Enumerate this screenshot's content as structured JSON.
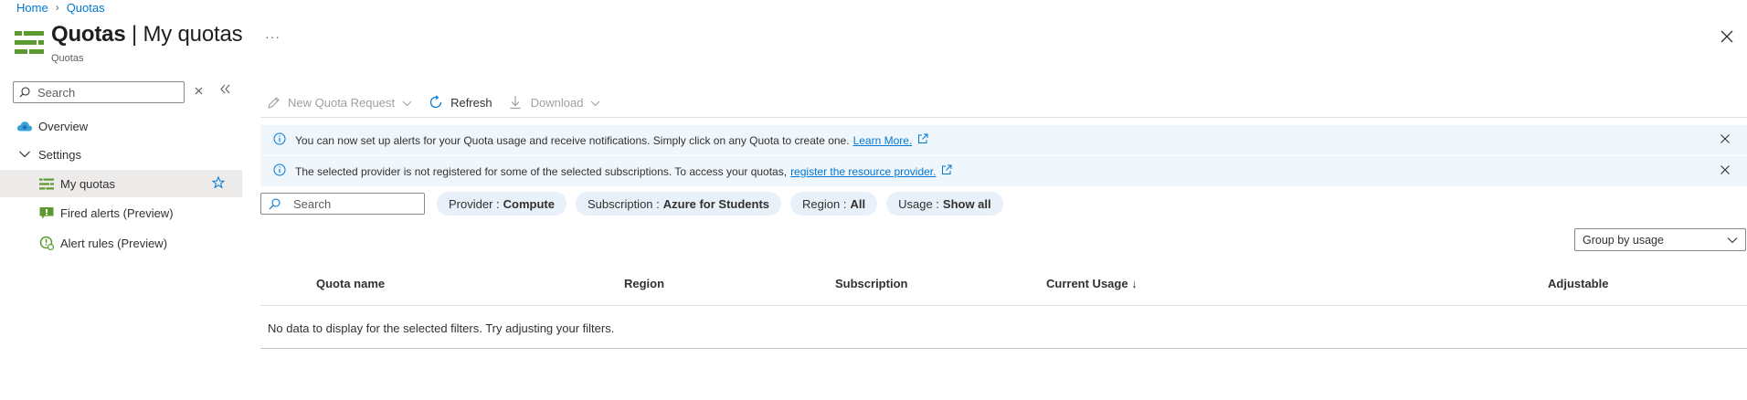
{
  "breadcrumb": {
    "home": "Home",
    "separator": "›",
    "current": "Quotas"
  },
  "header": {
    "title_main": "Quotas",
    "title_sep": " | ",
    "title_sub": "My quotas",
    "subtitle": "Quotas",
    "more": "···",
    "icon": "quotas-icon",
    "close_icon": "close-icon"
  },
  "nav": {
    "search_placeholder": "Search",
    "clear_icon": "clear-icon",
    "collapse_icon": "collapse-icon",
    "items": [
      {
        "label": "Overview",
        "icon": "cloud-icon",
        "selected": false,
        "indent": 0
      },
      {
        "label": "Settings",
        "icon": "chevron-down-icon",
        "selected": false,
        "indent": 0
      },
      {
        "label": "My quotas",
        "icon": "list-icon",
        "selected": true,
        "indent": 1,
        "favorite": "star-icon"
      },
      {
        "label": "Fired alerts (Preview)",
        "icon": "alert-icon",
        "selected": false,
        "indent": 1
      },
      {
        "label": "Alert rules (Preview)",
        "icon": "alert-rule-icon",
        "selected": false,
        "indent": 1
      }
    ]
  },
  "toolbar": {
    "new_quota": "New Quota Request",
    "refresh": "Refresh",
    "download": "Download"
  },
  "banners": [
    {
      "text": "You can now set up alerts for your Quota usage and receive notifications. Simply click on any Quota to create one.",
      "link": "Learn More."
    },
    {
      "text": "The selected provider is not registered for some of the selected subscriptions. To access your quotas,",
      "link": "register the resource provider."
    }
  ],
  "filters": {
    "search_placeholder": "Search",
    "pills": [
      {
        "key": "Provider :",
        "value": "Compute"
      },
      {
        "key": "Subscription :",
        "value": "Azure for Students"
      },
      {
        "key": "Region :",
        "value": "All"
      },
      {
        "key": "Usage :",
        "value": "Show all"
      }
    ],
    "group_by": "Group by usage"
  },
  "table": {
    "columns": [
      "Quota name",
      "Region",
      "Subscription",
      "Current Usage ↓",
      "Adjustable"
    ],
    "empty_message": "No data to display for the selected filters. Try adjusting your filters."
  },
  "colors": {
    "accent": "#0078d4",
    "brand_green": "#5c9a2f",
    "banner_bg": "#eff6fc",
    "pill_bg": "#e8f0f9",
    "selected_bg": "#edebe9"
  }
}
